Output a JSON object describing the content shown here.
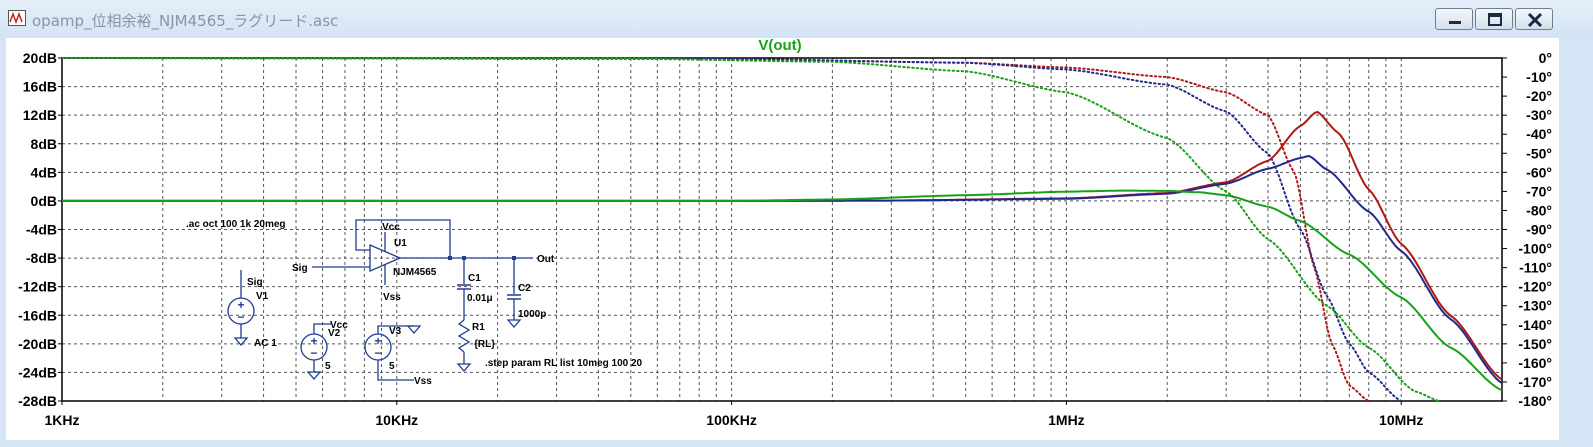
{
  "window": {
    "title": "opamp_位相余裕_NJM4565_ラグリード.asc",
    "buttons": [
      "minimize",
      "maximize",
      "close"
    ],
    "icons": [
      "schematic-app-icon",
      "minimize-icon",
      "maximize-icon",
      "close-icon"
    ]
  },
  "chart_data": {
    "type": "line",
    "title": "V(out)",
    "title_color": "#17a317",
    "x_scale": "log",
    "x_unit": "Hz",
    "xlim": [
      1000,
      20000000
    ],
    "x_ticks": [
      {
        "value": 1000,
        "label": "1KHz"
      },
      {
        "value": 10000,
        "label": "10KHz"
      },
      {
        "value": 100000,
        "label": "100KHz"
      },
      {
        "value": 1000000,
        "label": "1MHz"
      },
      {
        "value": 10000000,
        "label": "10MHz"
      }
    ],
    "left_axis": {
      "ylim": [
        -28,
        20
      ],
      "labels": [
        "20dB",
        "16dB",
        "12dB",
        "8dB",
        "4dB",
        "0dB",
        "-4dB",
        "-8dB",
        "-12dB",
        "-16dB",
        "-20dB",
        "-24dB",
        "-28dB"
      ]
    },
    "right_axis": {
      "ylim": [
        -180,
        0
      ],
      "labels": [
        "0°",
        "-10°",
        "-20°",
        "-30°",
        "-40°",
        "-50°",
        "-60°",
        "-70°",
        "-80°",
        "-90°",
        "-100°",
        "-110°",
        "-120°",
        "-130°",
        "-140°",
        "-150°",
        "-160°",
        "-170°",
        "-180°"
      ]
    },
    "grid": true,
    "series": [
      {
        "color": "#b01818",
        "axis": "left",
        "style": "solid",
        "x": [
          1000,
          10000,
          100000,
          300000,
          1000000,
          2000000,
          3000000,
          4000000,
          5000000,
          5600000,
          6500000,
          8000000,
          10000000,
          14000000,
          20000000
        ],
        "y": [
          0,
          0,
          0,
          0.05,
          0.35,
          1.1,
          2.6,
          5.6,
          10.5,
          12.5,
          9.5,
          1.6,
          -6,
          -16,
          -25
        ]
      },
      {
        "color": "#202a8c",
        "axis": "left",
        "style": "solid",
        "x": [
          1000,
          10000,
          100000,
          300000,
          1000000,
          2000000,
          3000000,
          4000000,
          5000000,
          5300000,
          6000000,
          8000000,
          10000000,
          14000000,
          20000000
        ],
        "y": [
          0,
          0,
          0,
          0.05,
          0.3,
          1.0,
          2.4,
          4.5,
          6.0,
          6.3,
          4.4,
          -1.5,
          -7,
          -16.5,
          -25.5
        ]
      },
      {
        "color": "#18a018",
        "axis": "left",
        "style": "solid",
        "x": [
          1000,
          100000,
          200000,
          500000,
          1000000,
          1500000,
          2000000,
          2500000,
          3000000,
          4000000,
          5000000,
          7000000,
          10000000,
          14000000,
          20000000
        ],
        "y": [
          0,
          0,
          0.2,
          0.8,
          1.3,
          1.45,
          1.4,
          1.2,
          0.8,
          -0.8,
          -2.8,
          -7.5,
          -13.5,
          -20.5,
          -26.5
        ]
      },
      {
        "color": "#b01818",
        "axis": "right",
        "style": "dotted",
        "x": [
          1000,
          100000,
          500000,
          1000000,
          2000000,
          3000000,
          4000000,
          4800000,
          5500000,
          6200000,
          7000000,
          8000000
        ],
        "y": [
          0,
          -0.5,
          -2.5,
          -5,
          -10,
          -18,
          -30,
          -60,
          -110,
          -150,
          -172,
          -180
        ]
      },
      {
        "color": "#202a8c",
        "axis": "right",
        "style": "dotted",
        "x": [
          1000,
          100000,
          500000,
          1000000,
          2000000,
          3000000,
          4000000,
          5000000,
          6000000,
          7000000,
          8000000,
          10000000
        ],
        "y": [
          0,
          -0.5,
          -2.5,
          -6,
          -14,
          -28,
          -50,
          -90,
          -125,
          -150,
          -165,
          -180
        ]
      },
      {
        "color": "#18a018",
        "axis": "right",
        "style": "dotted",
        "x": [
          1000,
          50000,
          200000,
          500000,
          1000000,
          2000000,
          3000000,
          4000000,
          6000000,
          8000000,
          11000000,
          13000000
        ],
        "y": [
          0,
          -0.4,
          -2,
          -7,
          -18,
          -42,
          -70,
          -95,
          -130,
          -152,
          -175,
          -180
        ]
      }
    ]
  },
  "schematic": {
    "directives": {
      "ac": ".ac oct 100 1k 20meg",
      "step": ".step param RL list 10meg 100 20"
    },
    "labels": {
      "sig_in": "Sig",
      "sig_v1": "Sig",
      "vcc_u1": "Vcc",
      "u1": "U1",
      "u1_model": "NJM4565",
      "vss_u1": "Vss",
      "out": "Out",
      "c1": "C1",
      "c1_value": "0.01μ",
      "c2": "C2",
      "c2_value": "1000p",
      "r1": "R1",
      "r1_value": "{RL}",
      "v1": "V1",
      "v1_value": "AC 1",
      "v2": "V2",
      "v2_value": "5",
      "vcc_v2": "Vcc",
      "v3": "V3",
      "v3_value": "5",
      "vss_v3": "Vss"
    }
  }
}
